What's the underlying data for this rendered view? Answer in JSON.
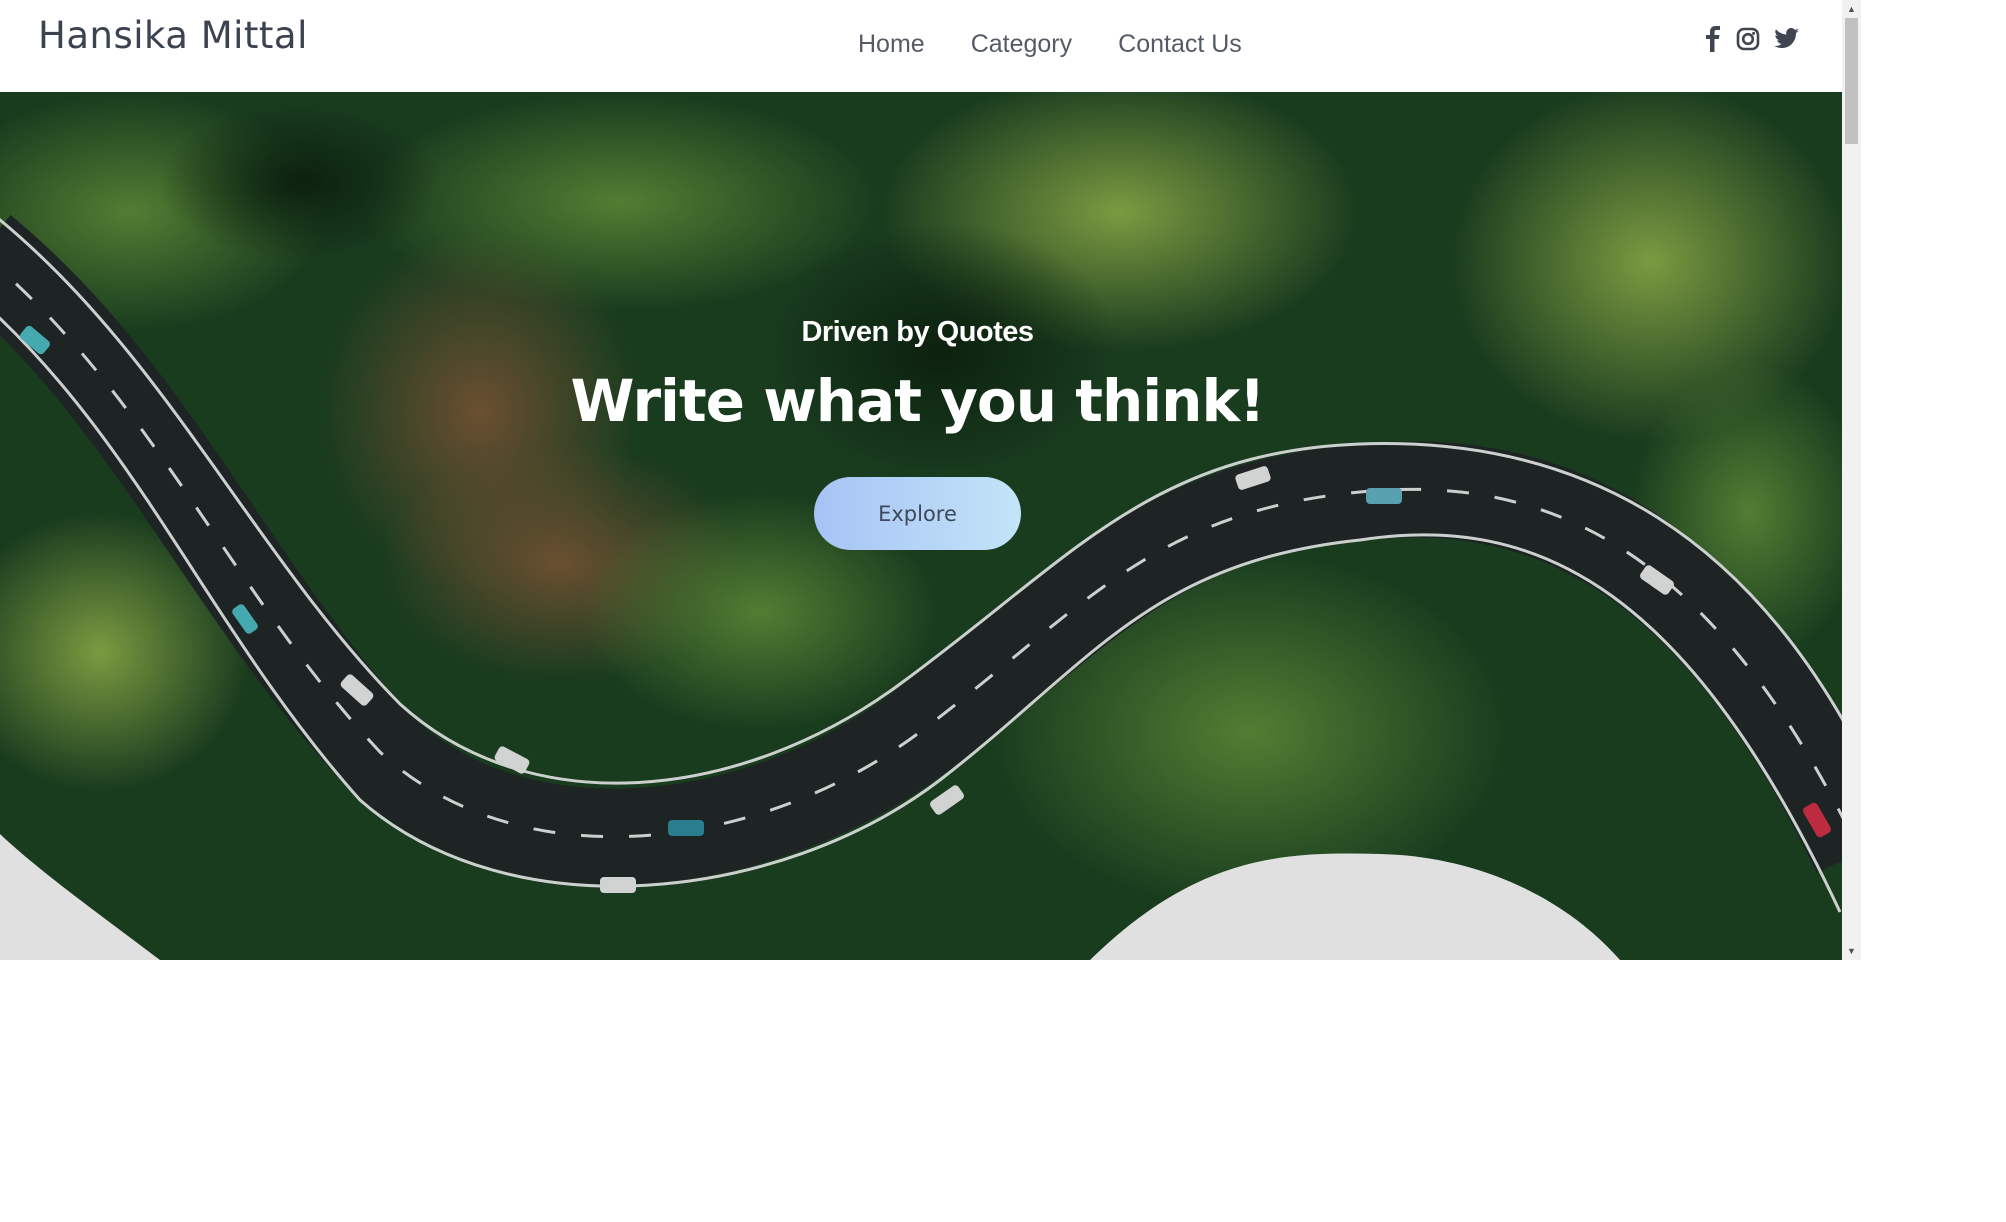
{
  "header": {
    "brand": "Hansika Mittal",
    "nav": [
      {
        "label": "Home"
      },
      {
        "label": "Category"
      },
      {
        "label": "Contact Us"
      }
    ],
    "social": [
      "facebook-icon",
      "instagram-icon",
      "twitter-icon"
    ]
  },
  "hero": {
    "subtitle": "Driven by Quotes",
    "title": "Write what you think!",
    "button": "Explore",
    "background": "aerial photo of a winding road through a forest"
  },
  "colors": {
    "nav_text": "#555b66",
    "brand_text": "#3b4350",
    "button_gradient_start": "#a7c3f6",
    "button_gradient_end": "#c3e4f8",
    "forest_dark": "#173a1c",
    "road": "#23282a"
  }
}
